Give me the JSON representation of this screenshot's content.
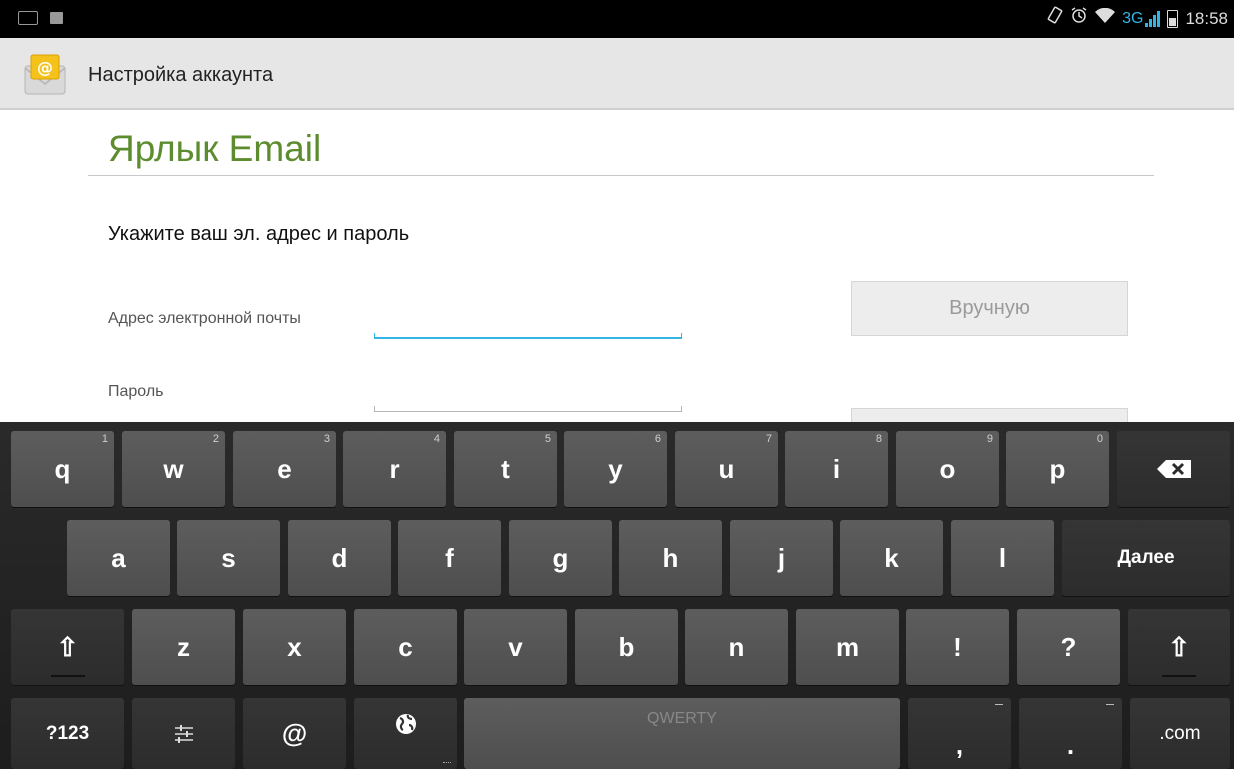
{
  "status_bar": {
    "left_icons": [
      "keyboard-icon",
      "image-icon"
    ],
    "right_icons": [
      "rotate-icon",
      "alarm-icon",
      "wifi-icon",
      "signal-icon",
      "battery-icon"
    ],
    "network": "3G",
    "time": "18:58",
    "accent_color": "#33b5e5"
  },
  "action_bar": {
    "title": "Настройка аккаунта",
    "icon": "email-app-icon"
  },
  "form": {
    "heading": "Ярлык Email",
    "heading_color": "#5d8c2f",
    "instruction": "Укажите ваш эл. адрес и пароль",
    "email_label": "Адрес электронной почты",
    "email_value": "",
    "password_label": "Пароль",
    "password_value": "",
    "manual_button": "Вручную",
    "focus_color": "#33b5e5"
  },
  "keyboard": {
    "row1": [
      {
        "label": "q",
        "hint": "1"
      },
      {
        "label": "w",
        "hint": "2"
      },
      {
        "label": "e",
        "hint": "3"
      },
      {
        "label": "r",
        "hint": "4"
      },
      {
        "label": "t",
        "hint": "5"
      },
      {
        "label": "y",
        "hint": "6"
      },
      {
        "label": "u",
        "hint": "7"
      },
      {
        "label": "i",
        "hint": "8"
      },
      {
        "label": "o",
        "hint": "9"
      },
      {
        "label": "p",
        "hint": "0"
      }
    ],
    "backspace_icon": "backspace-icon",
    "row2": [
      "a",
      "s",
      "d",
      "f",
      "g",
      "h",
      "j",
      "k",
      "l"
    ],
    "next_label": "Далее",
    "row3": [
      "z",
      "x",
      "c",
      "v",
      "b",
      "n",
      "m",
      "!",
      "?"
    ],
    "shift_glyph": "⇧",
    "mode_label": "?123",
    "settings_icon": "settings-sliders-icon",
    "at_label": "@",
    "language_icon": "globe-icon",
    "space_label": "QWERTY",
    "comma_label": ",",
    "period_label": ".",
    "dotcom_label": ".com"
  }
}
